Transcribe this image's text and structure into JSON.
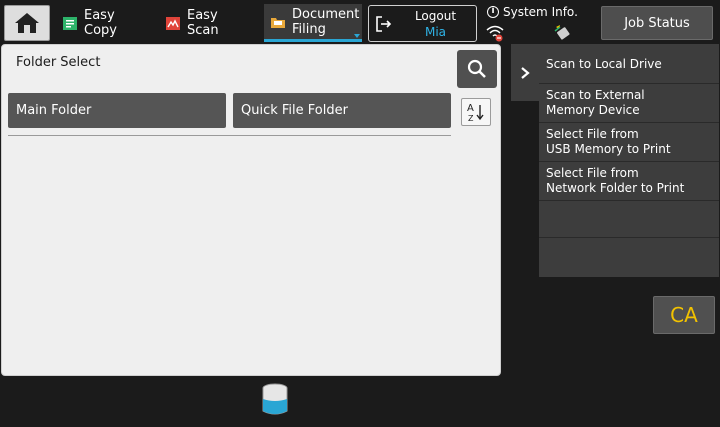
{
  "topbar": {
    "tabs": [
      {
        "line1": "Easy",
        "line2": "Copy"
      },
      {
        "line1": "Easy",
        "line2": "Scan"
      },
      {
        "line1": "Document",
        "line2": "Filing"
      }
    ],
    "logout": {
      "label": "Logout",
      "user": "Mia"
    },
    "system_info": "System Info.",
    "job_status": "Job Status"
  },
  "dialog": {
    "title": "Folder Select",
    "folders": [
      "Main Folder",
      "Quick File Folder"
    ]
  },
  "actions": [
    {
      "line1": "Scan to Local Drive",
      "line2": ""
    },
    {
      "line1": "Scan to External",
      "line2": "Memory Device"
    },
    {
      "line1": "Select File from",
      "line2": "USB Memory to Print"
    },
    {
      "line1": "Select File from",
      "line2": "Network Folder to Print"
    }
  ],
  "ca_label": "CA",
  "colors": {
    "accent": "#2aa6d4",
    "user_text": "#2fb3e6",
    "ca_text": "#f2c200",
    "panel": "#3d3d3d"
  }
}
